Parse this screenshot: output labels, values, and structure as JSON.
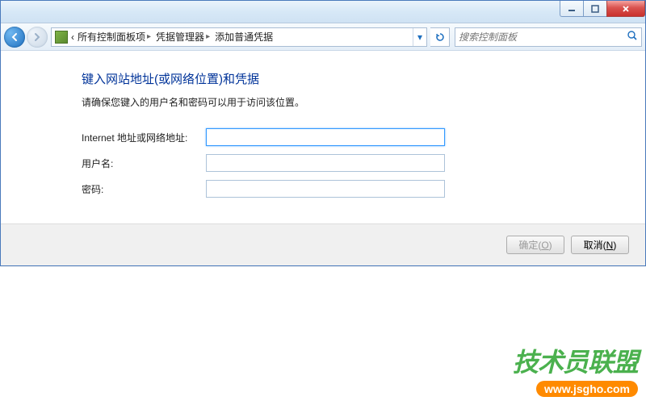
{
  "window": {
    "minimize_title": "Minimize",
    "maximize_title": "Maximize",
    "close_title": "Close"
  },
  "nav": {
    "back_title": "Back",
    "forward_title": "Forward",
    "refresh_title": "Refresh",
    "crumbs": [
      {
        "label": "所有控制面板项"
      },
      {
        "label": "凭据管理器"
      },
      {
        "label": "添加普通凭据"
      }
    ],
    "search_placeholder": "搜索控制面板"
  },
  "page": {
    "heading": "键入网站地址(或网络位置)和凭据",
    "subtext": "请确保您键入的用户名和密码可以用于访问该位置。",
    "fields": {
      "address_label": "Internet 地址或网络地址:",
      "username_label": "用户名:",
      "password_label": "密码:",
      "address_value": "",
      "username_value": "",
      "password_value": ""
    }
  },
  "footer": {
    "ok_prefix": "确定(",
    "ok_key": "O",
    "ok_suffix": ")",
    "cancel_prefix": "取消(",
    "cancel_key": "N",
    "cancel_suffix": ")"
  },
  "watermark": {
    "brand": "技术员联盟",
    "url": "www.jsgho.com"
  }
}
